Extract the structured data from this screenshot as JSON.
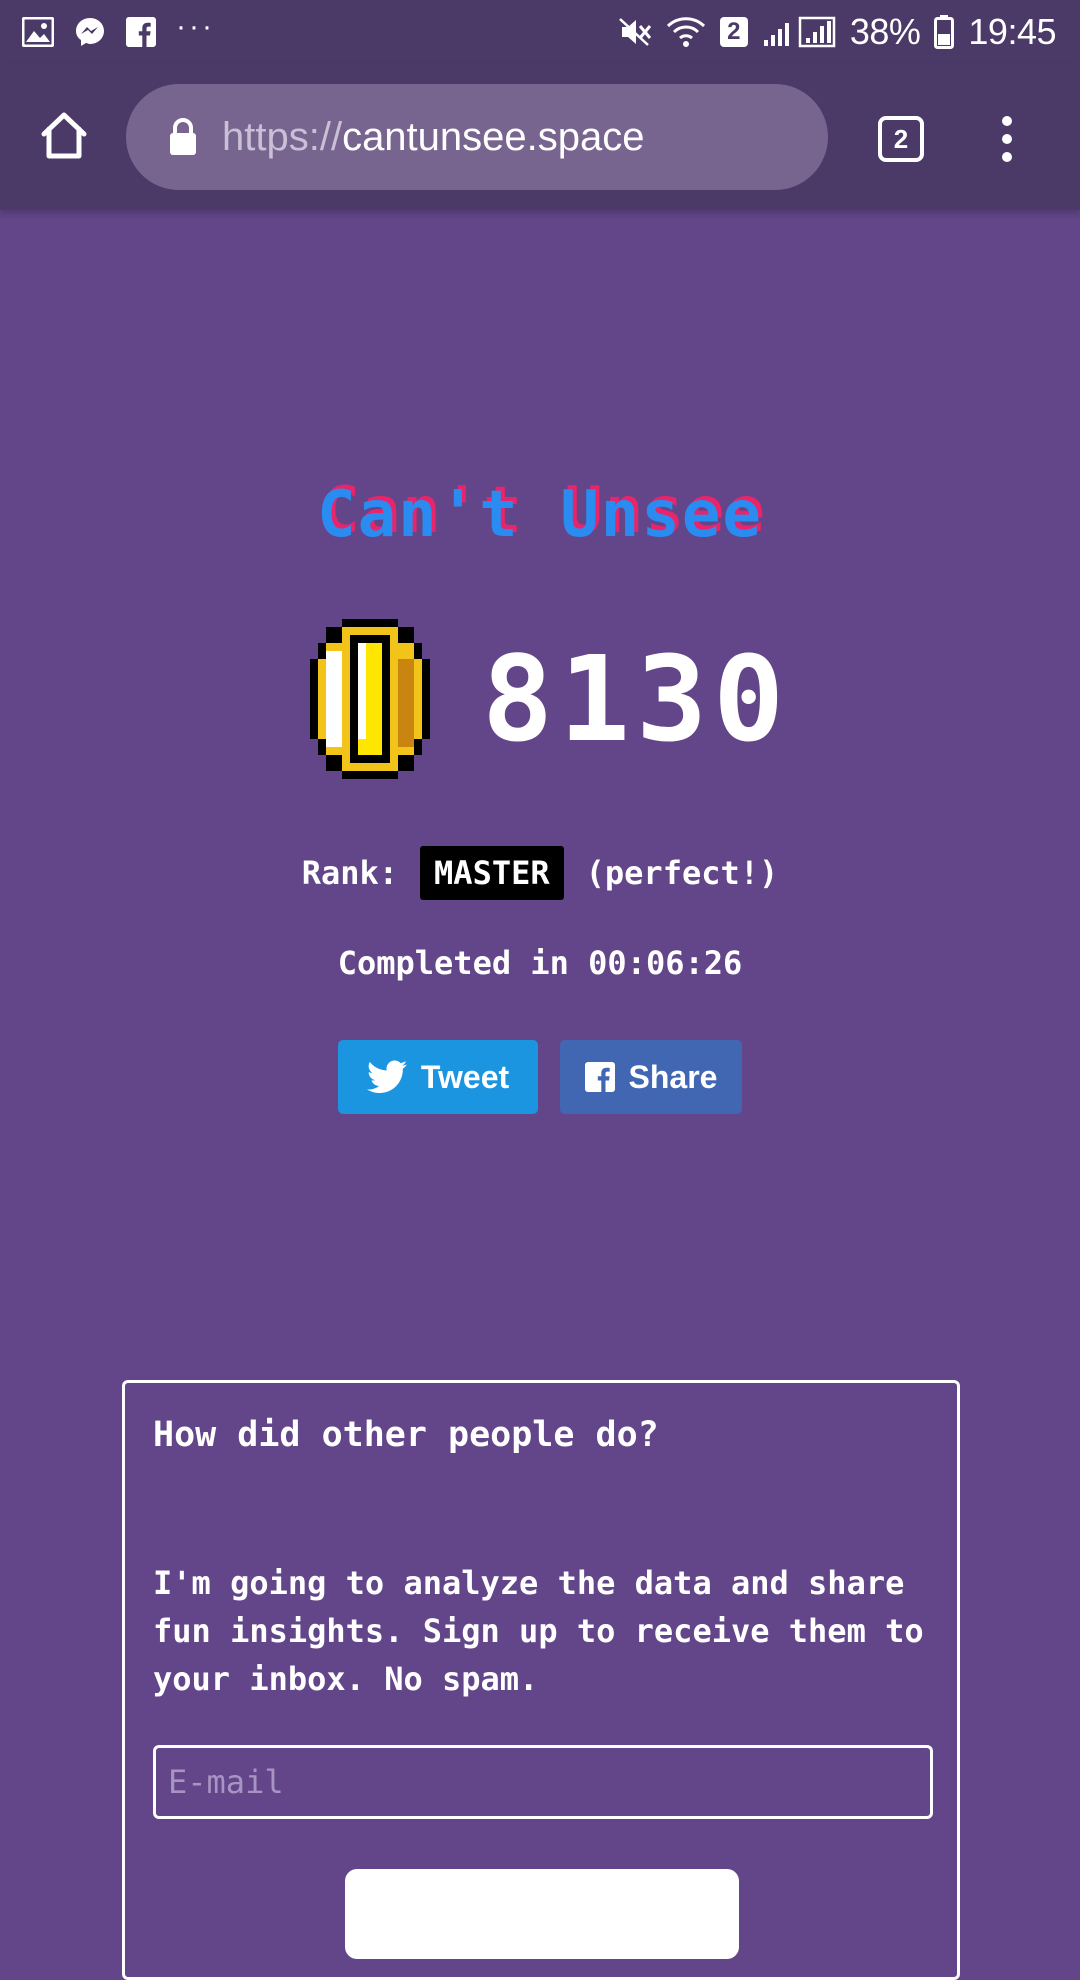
{
  "status_bar": {
    "notification_icons": [
      "gallery-icon",
      "messenger-icon",
      "facebook-icon"
    ],
    "more": "···",
    "sim_label": "2",
    "battery": "38%",
    "time": "19:45"
  },
  "browser": {
    "url_scheme": "https://",
    "url_host": "cantunsee.space",
    "tab_count": "2"
  },
  "game": {
    "logo": "Can't Unsee",
    "score": "8130",
    "rank_label": "Rank:",
    "rank_value": "MASTER",
    "rank_note": "(perfect!)",
    "completed_label": "Completed in",
    "completed_time": "00:06:26"
  },
  "share": {
    "tweet_label": "Tweet",
    "share_label": "Share"
  },
  "signup": {
    "title": "How did other people do?",
    "body": "I'm going to analyze the data and share fun insights. Sign up to receive them to your inbox. No spam.",
    "email_placeholder": "E-mail",
    "submit_label": ""
  },
  "colors": {
    "page_bg": "#624689",
    "toolbar_bg": "#4b3a68",
    "tweet_blue": "#1b95e0",
    "facebook_blue": "#4267b2",
    "logo_blue": "#2a8cf0",
    "logo_pink": "#e8246a",
    "coin_gold": "#f2c318"
  }
}
